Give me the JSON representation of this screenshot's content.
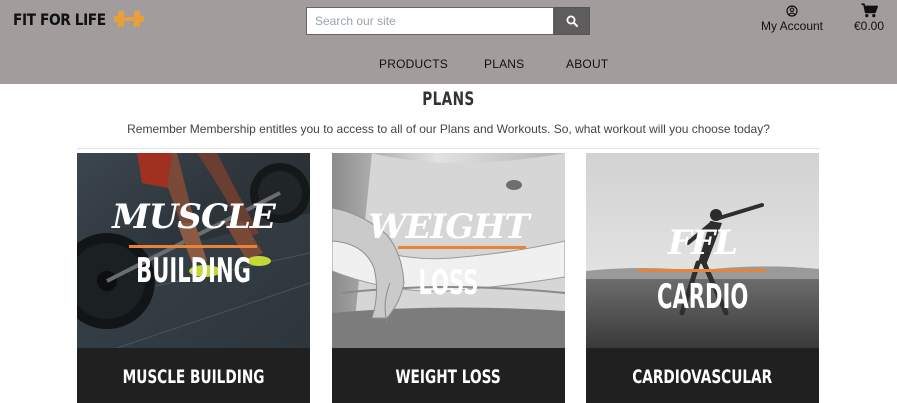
{
  "header": {
    "logo_text": "FIT FOR LIFE",
    "search_placeholder": "Search our site",
    "account_label": "My Account",
    "cart_total": "€0.00"
  },
  "nav": {
    "items": [
      "PRODUCTS",
      "PLANS",
      "ABOUT"
    ]
  },
  "page": {
    "title": "PLANS",
    "subtitle": "Remember Membership entitles you to access to all of our Plans and Workouts. So, what workout will you choose today?"
  },
  "plans": [
    {
      "overlay_top": "MUSCLE",
      "overlay_bottom": "BUILDING",
      "label": "MUSCLE BUILDING"
    },
    {
      "overlay_top": "WEIGHT",
      "overlay_bottom": "LOSS",
      "label": "WEIGHT LOSS"
    },
    {
      "overlay_top": "FFL",
      "overlay_bottom": "CARDIO",
      "label": "CARDIOVASCULAR"
    }
  ],
  "colors": {
    "header_bg": "#a29c9c",
    "accent": "#e8833a",
    "card_footer": "#202020"
  },
  "icons": [
    "dumbbell-icon",
    "search-icon",
    "user-circle-icon",
    "shopping-cart-icon"
  ]
}
